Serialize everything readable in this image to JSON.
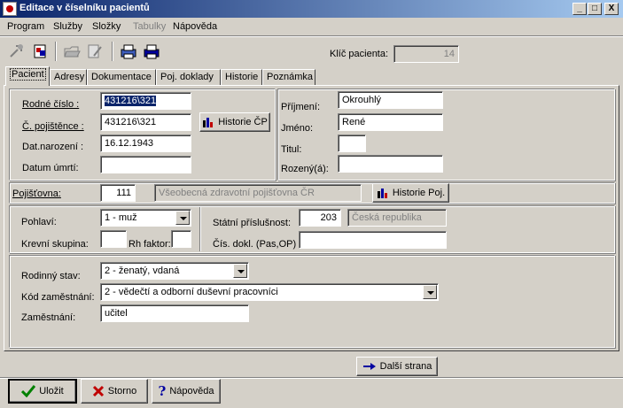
{
  "window": {
    "title": "Editace v číselníku pacientů",
    "minimize": "_",
    "maximize": "□",
    "close": "X"
  },
  "menu": [
    "Program",
    "Služby",
    "Složky",
    "Tabulky",
    "Nápověda"
  ],
  "patient_key": {
    "label": "Klíč pacienta:",
    "value": "14"
  },
  "tabs": [
    "Pacient",
    "Adresy",
    "Dokumentace",
    "Poj. doklady",
    "Historie",
    "Poznámka"
  ],
  "personal": {
    "rodne_cislo_label": "Rodné číslo :",
    "rodne_cislo": "431216\\321",
    "cislo_pojistence_label": "Č. pojištěnce :",
    "cislo_pojistence": "431216\\321",
    "historie_cp": "Historie ČP",
    "dat_narozeni_label": "Dat.narození :",
    "dat_narozeni": "16.12.1943",
    "datum_umrti_label": "Datum  úmrtí:",
    "datum_umrti": "",
    "prijmeni_label": "Příjmení:",
    "prijmeni": "Okrouhlý",
    "jmeno_label": "Jméno:",
    "jmeno": "René",
    "titul_label": "Titul:",
    "titul": "",
    "rozeny_label": "Rozený(á):",
    "rozeny": ""
  },
  "insurance": {
    "label": "Pojišťovna:",
    "code": "111",
    "name": "Všeobecná zdravotní pojišťovna ČR",
    "historie_poj": "Historie Poj."
  },
  "demographics": {
    "pohlavi_label": "Pohlaví:",
    "pohlavi": "1 - muž",
    "krevni_label": "Krevní skupina:",
    "krevni": "",
    "rh_label": "Rh faktor:",
    "rh": "",
    "statni_label": "Státní příslušnost:",
    "statni_code": "203",
    "statni_name": "Česká republika",
    "cis_dokl_label": "Čís. dokl. (Pas,OP)",
    "cis_dokl": ""
  },
  "employment": {
    "rodinny_stav_label": "Rodinný stav:",
    "rodinny_stav": "2 - ženatý, vdaná",
    "kod_zam_label": "Kód zaměstnání:",
    "kod_zam": "2  - vědečtí a odborní duševní pracovníci",
    "zamestnani_label": "Zaměstnání:",
    "zamestnani": "učitel"
  },
  "buttons": {
    "dalsi_strana": "Další strana",
    "ulozit": "Uložit",
    "storno": "Storno",
    "napoveda": "Nápověda"
  },
  "colors": {
    "titlebar": "#0a246a",
    "face": "#d4d0c8",
    "selection": "#0a246a"
  }
}
